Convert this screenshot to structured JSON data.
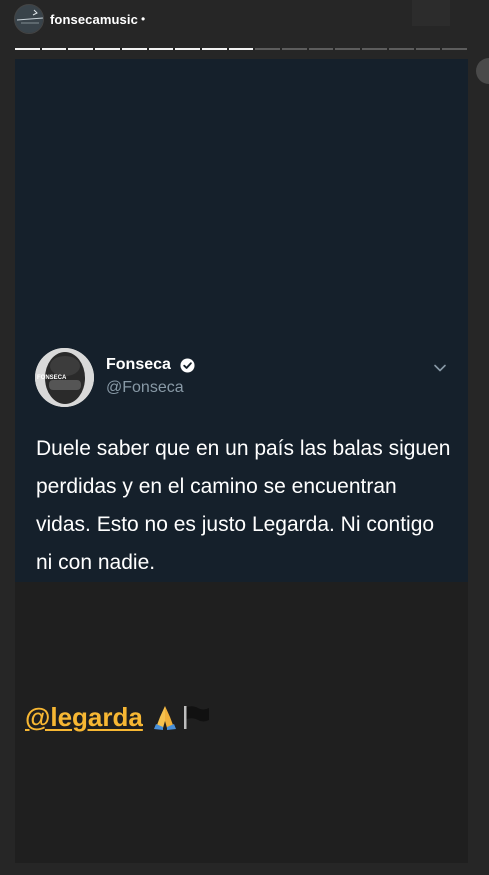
{
  "header": {
    "username": "fonsecamusic",
    "separator": "•",
    "avatar_icon": "profile-avatar",
    "progress": {
      "total_segments": 17,
      "completed_segments": 9
    }
  },
  "tweet": {
    "name": "Fonseca",
    "handle": "@Fonseca",
    "verified_icon": "verified-badge-icon",
    "menu_icon": "chevron-down-icon",
    "avatar_caption": "FONSECA",
    "text": "Duele saber que en un país las balas siguen perdidas y en el camino se encuentran vidas. Esto no es justo Legarda. Ni contigo ni con nadie."
  },
  "caption": {
    "mention": "@legarda",
    "emoji": [
      "folded-hands",
      "black-flag"
    ]
  },
  "colors": {
    "background": "#262626",
    "tweet_background": "#15202b",
    "mention": "#f7b733",
    "handle": "#8899a6"
  }
}
